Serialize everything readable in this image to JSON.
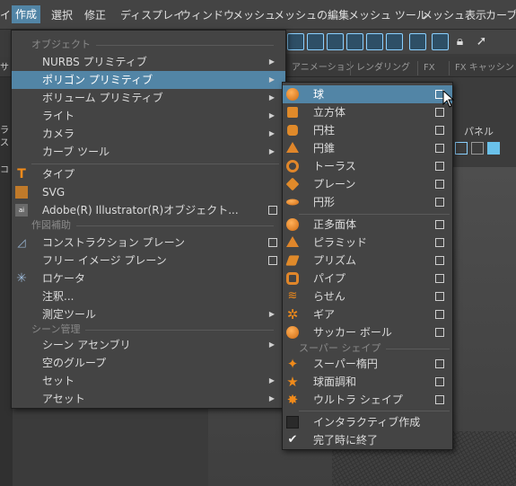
{
  "menubar": {
    "items": [
      {
        "label": "イ",
        "active": false
      },
      {
        "label": "作成",
        "active": true
      },
      {
        "label": "選択",
        "active": false
      },
      {
        "label": "修正",
        "active": false
      },
      {
        "label": "ディスプレイ",
        "active": false
      },
      {
        "label": "ウィンドウ",
        "active": false
      },
      {
        "label": "メッシュ",
        "active": false
      },
      {
        "label": "メッシュの編集",
        "active": false
      },
      {
        "label": "メッシュ ツール",
        "active": false
      },
      {
        "label": "メッシュ表示",
        "active": false
      },
      {
        "label": "カーブ",
        "active": false
      }
    ]
  },
  "background": {
    "tabs": [
      "アニメーション",
      "レンダリング",
      "FX",
      "FX キャッシン"
    ],
    "right_panel_label": "パネル",
    "left_texts": [
      "サ",
      "ラ",
      "ス",
      "コ"
    ]
  },
  "create_menu": {
    "sections": {
      "objects": "オブジェクト",
      "construction": "作図補助",
      "scene": "シーン管理"
    },
    "items": {
      "nurbs": "NURBS プリミティブ",
      "polygon": "ポリゴン プリミティブ",
      "volume": "ボリューム プリミティブ",
      "lights": "ライト",
      "cameras": "カメラ",
      "curve_tools": "カーブ ツール",
      "type": "タイプ",
      "svg": "SVG",
      "illustrator": "Adobe(R) Illustrator(R)オブジェクト...",
      "construction_plane": "コンストラクション プレーン",
      "free_image_plane": "フリー イメージ プレーン",
      "locator": "ロケータ",
      "annotation": "注釈...",
      "measure_tools": "測定ツール",
      "scene_assembly": "シーン アセンブリ",
      "empty_group": "空のグループ",
      "sets": "セット",
      "assets": "アセット"
    }
  },
  "polygon_submenu": {
    "section_super": "スーパー シェイプ",
    "items": {
      "sphere": "球",
      "cube": "立方体",
      "cylinder": "円柱",
      "cone": "円錐",
      "torus": "トーラス",
      "plane": "プレーン",
      "disc": "円形",
      "platonic": "正多面体",
      "pyramid": "ピラミッド",
      "prism": "プリズム",
      "pipe": "パイプ",
      "helix": "らせん",
      "gear": "ギア",
      "soccer_ball": "サッカー ボール",
      "super_ellipse": "スーパー楕円",
      "sph_harmonics": "球面調和",
      "ultra_shape": "ウルトラ シェイプ",
      "interactive_creation": "インタラクティブ作成",
      "exit_on_completion": "完了時に終了"
    },
    "exit_on_completion_checked": true
  },
  "colors": {
    "highlight": "#5285a6",
    "menu_bg": "#444444",
    "icon_orange": "#e0862a",
    "shelf_accent": "#8ad0ff"
  }
}
